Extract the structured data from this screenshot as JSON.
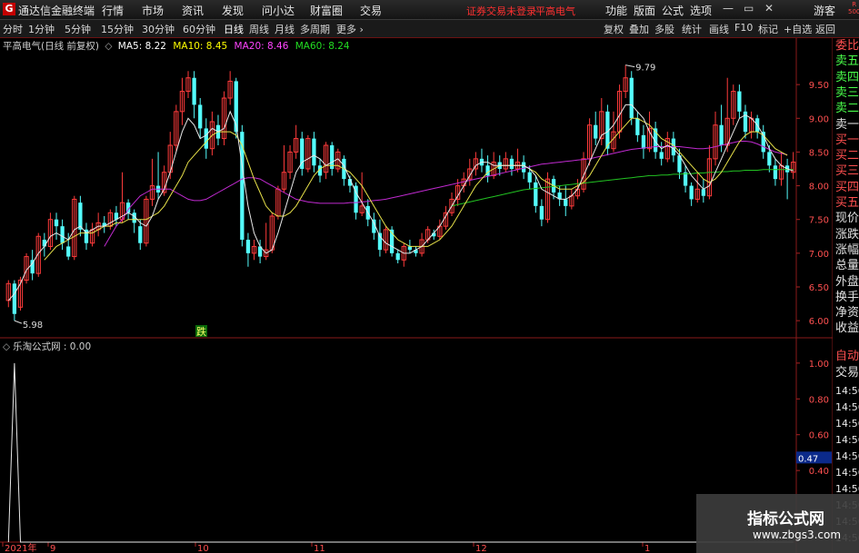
{
  "app": {
    "logo_char": "G",
    "title": "通达信金融终端",
    "menu": [
      "行情",
      "市场",
      "资讯",
      "发现",
      "问小达",
      "财富圈",
      "交易"
    ],
    "login_status": "证券交易未登录",
    "stock_name": "平高电气",
    "right_menu": [
      "功能",
      "版面",
      "公式",
      "选项"
    ],
    "guest": "游客",
    "window_controls": [
      "—",
      "▭",
      "✕"
    ],
    "badge": "R\n500"
  },
  "toolbar": {
    "periods": [
      "分时",
      "1分钟",
      "5分钟",
      "15分钟",
      "30分钟",
      "60分钟",
      "日线",
      "周线",
      "月线",
      "多周期",
      "更多 ›"
    ],
    "active_period": "日线",
    "buttons": [
      "复权",
      "叠加",
      "多股",
      "统计",
      "画线",
      "F10",
      "标记",
      "+自选",
      "返回"
    ],
    "settings_icon": "◇"
  },
  "main_chart": {
    "stock_label": "平高电气(日线 前复权)",
    "ma_labels": [
      {
        "text": "MA5: 8.22",
        "color": "#ffffff"
      },
      {
        "text": "MA10: 8.45",
        "color": "#ffff00"
      },
      {
        "text": "MA20: 8.46",
        "color": "#ff00ff"
      },
      {
        "text": "MA60: 8.24",
        "color": "#00dd00"
      }
    ],
    "high_marker": "9.79",
    "low_marker": "5.98",
    "signal_marker": "跌",
    "price_axis": [
      "9.50",
      "9.00",
      "8.50",
      "8.00",
      "7.50",
      "7.00",
      "6.50",
      "6.00"
    ]
  },
  "sub_chart": {
    "label": "乐淘公式网 : 0.00",
    "axis": [
      "1.00",
      "0.80",
      "0.60",
      "0.40"
    ],
    "current_value": "0.47"
  },
  "date_axis": [
    "2021年",
    "9",
    "10",
    "11",
    "12",
    "1"
  ],
  "side_panel": {
    "quote_labels": [
      "委比",
      "卖五",
      "卖四",
      "卖三",
      "卖二",
      "卖一",
      "买一",
      "买二",
      "买三",
      "买四",
      "买五",
      "现价",
      "涨跌",
      "涨幅",
      "总量",
      "外盘",
      "换手",
      "净资",
      "收益"
    ],
    "lower_labels": [
      "自动",
      "交易"
    ],
    "times": [
      "14:56",
      "14:56",
      "14:56",
      "14:56",
      "14:56",
      "14:56",
      "14:56",
      "14:56",
      "14:56",
      "14:56"
    ]
  },
  "watermark": {
    "title": "指标公式网",
    "url": "www.zbgs3.com"
  },
  "chart_data": {
    "type": "candlestick",
    "ylim": [
      5.8,
      10.0
    ],
    "up_color": "#ff3b3b",
    "down_color": "#54fcfc",
    "candles": [
      [
        6.3,
        6.55,
        6.2,
        6.6
      ],
      [
        6.55,
        6.1,
        6.0,
        6.6
      ],
      [
        6.2,
        6.6,
        6.15,
        6.65
      ],
      [
        6.6,
        6.95,
        6.55,
        7.0
      ],
      [
        6.9,
        6.7,
        6.6,
        7.05
      ],
      [
        6.7,
        7.25,
        6.65,
        7.3
      ],
      [
        7.2,
        7.1,
        6.95,
        7.3
      ],
      [
        7.1,
        7.5,
        7.05,
        7.6
      ],
      [
        7.5,
        7.4,
        7.2,
        7.6
      ],
      [
        7.4,
        7.15,
        7.05,
        7.5
      ],
      [
        7.1,
        6.95,
        6.9,
        7.3
      ],
      [
        6.95,
        7.8,
        6.9,
        7.85
      ],
      [
        7.75,
        7.35,
        7.25,
        7.85
      ],
      [
        7.35,
        7.15,
        7.05,
        7.45
      ],
      [
        7.15,
        7.35,
        7.1,
        7.45
      ],
      [
        7.35,
        7.45,
        7.25,
        7.6
      ],
      [
        7.45,
        7.4,
        7.3,
        7.55
      ],
      [
        7.4,
        7.6,
        7.35,
        7.65
      ],
      [
        7.6,
        7.5,
        7.4,
        7.7
      ],
      [
        7.5,
        7.75,
        7.45,
        8.2
      ],
      [
        7.75,
        7.6,
        7.5,
        7.8
      ],
      [
        7.6,
        7.45,
        7.3,
        7.65
      ],
      [
        7.4,
        7.15,
        7.05,
        7.5
      ],
      [
        7.15,
        7.8,
        7.1,
        7.85
      ],
      [
        7.8,
        8.0,
        7.7,
        8.4
      ],
      [
        8.0,
        7.9,
        7.8,
        8.5
      ],
      [
        7.9,
        8.2,
        7.85,
        8.3
      ],
      [
        8.2,
        8.6,
        8.1,
        8.8
      ],
      [
        8.6,
        9.1,
        8.5,
        9.2
      ],
      [
        9.1,
        9.4,
        8.9,
        9.6
      ],
      [
        9.4,
        9.6,
        9.3,
        9.7
      ],
      [
        9.6,
        9.2,
        9.0,
        9.7
      ],
      [
        9.2,
        8.85,
        8.7,
        9.3
      ],
      [
        8.85,
        8.55,
        8.4,
        9.0
      ],
      [
        8.55,
        8.95,
        8.45,
        9.1
      ],
      [
        8.9,
        8.7,
        8.6,
        9.05
      ],
      [
        8.7,
        9.3,
        8.6,
        9.4
      ],
      [
        9.3,
        9.55,
        9.2,
        9.7
      ],
      [
        9.55,
        8.8,
        8.7,
        9.6
      ],
      [
        8.8,
        7.2,
        7.1,
        8.9
      ],
      [
        7.2,
        7.0,
        6.8,
        7.3
      ],
      [
        7.0,
        7.1,
        6.9,
        7.2
      ],
      [
        7.1,
        6.95,
        6.85,
        7.2
      ],
      [
        6.95,
        7.05,
        6.9,
        7.45
      ],
      [
        7.05,
        7.55,
        7.0,
        7.6
      ],
      [
        7.55,
        7.95,
        7.5,
        8.0
      ],
      [
        7.95,
        8.2,
        7.9,
        8.6
      ],
      [
        8.2,
        8.5,
        8.1,
        8.6
      ],
      [
        8.5,
        8.7,
        8.4,
        8.9
      ],
      [
        8.7,
        8.25,
        8.15,
        8.8
      ],
      [
        8.25,
        8.7,
        8.2,
        8.75
      ],
      [
        8.7,
        8.3,
        8.2,
        8.8
      ],
      [
        8.3,
        8.15,
        8.05,
        8.4
      ],
      [
        8.2,
        8.6,
        8.1,
        8.65
      ],
      [
        8.6,
        8.25,
        8.15,
        8.65
      ],
      [
        8.25,
        8.5,
        8.2,
        8.55
      ],
      [
        8.4,
        8.1,
        8.0,
        8.45
      ],
      [
        8.1,
        8.0,
        7.9,
        8.15
      ],
      [
        8.0,
        7.6,
        7.5,
        8.05
      ],
      [
        7.6,
        7.7,
        7.55,
        8.2
      ],
      [
        7.7,
        7.5,
        7.4,
        7.8
      ],
      [
        7.5,
        7.3,
        7.2,
        7.6
      ],
      [
        7.3,
        7.05,
        6.95,
        7.5
      ],
      [
        7.05,
        7.35,
        7.0,
        7.4
      ],
      [
        7.35,
        7.0,
        6.95,
        7.4
      ],
      [
        7.0,
        6.9,
        6.85,
        7.05
      ],
      [
        6.9,
        7.1,
        6.8,
        7.15
      ],
      [
        7.1,
        7.05,
        7.0,
        7.2
      ],
      [
        7.05,
        7.0,
        6.95,
        7.1
      ],
      [
        7.0,
        7.2,
        6.95,
        7.3
      ],
      [
        7.2,
        7.35,
        7.15,
        7.4
      ],
      [
        7.3,
        7.25,
        7.2,
        7.35
      ],
      [
        7.25,
        7.4,
        7.2,
        7.5
      ],
      [
        7.4,
        7.6,
        7.35,
        7.7
      ],
      [
        7.6,
        7.8,
        7.55,
        7.9
      ],
      [
        7.8,
        8.0,
        7.7,
        8.1
      ],
      [
        8.0,
        8.1,
        7.9,
        8.2
      ],
      [
        8.1,
        8.25,
        8.0,
        8.4
      ],
      [
        8.25,
        8.4,
        8.15,
        8.5
      ],
      [
        8.4,
        8.3,
        8.2,
        8.55
      ],
      [
        8.3,
        8.15,
        8.05,
        8.45
      ],
      [
        8.15,
        8.35,
        8.1,
        8.5
      ],
      [
        8.35,
        8.25,
        8.15,
        8.45
      ],
      [
        8.25,
        8.4,
        8.2,
        8.5
      ],
      [
        8.4,
        8.25,
        8.15,
        8.45
      ],
      [
        8.25,
        8.35,
        8.2,
        8.55
      ],
      [
        8.35,
        8.2,
        8.1,
        8.45
      ],
      [
        8.2,
        8.05,
        7.95,
        8.3
      ],
      [
        8.05,
        7.7,
        7.6,
        8.15
      ],
      [
        7.7,
        7.5,
        7.4,
        7.8
      ],
      [
        7.5,
        8.1,
        7.45,
        8.2
      ],
      [
        8.1,
        7.9,
        7.8,
        8.15
      ],
      [
        7.9,
        7.8,
        7.7,
        8.0
      ],
      [
        7.8,
        7.7,
        7.55,
        8.0
      ],
      [
        7.7,
        7.85,
        7.65,
        7.95
      ],
      [
        7.85,
        7.95,
        7.8,
        8.1
      ],
      [
        7.95,
        8.4,
        7.9,
        8.5
      ],
      [
        8.4,
        8.9,
        8.3,
        9.0
      ],
      [
        8.9,
        8.7,
        8.6,
        9.1
      ],
      [
        8.7,
        9.1,
        8.6,
        9.3
      ],
      [
        9.1,
        8.55,
        8.45,
        9.2
      ],
      [
        8.55,
        8.8,
        8.5,
        9.1
      ],
      [
        8.8,
        9.4,
        8.7,
        9.5
      ],
      [
        9.4,
        9.6,
        9.3,
        9.79
      ],
      [
        9.6,
        9.0,
        8.9,
        9.7
      ],
      [
        9.0,
        8.75,
        8.65,
        9.1
      ],
      [
        8.75,
        8.55,
        8.4,
        8.9
      ],
      [
        8.55,
        8.85,
        8.5,
        9.1
      ],
      [
        8.85,
        8.5,
        8.4,
        8.95
      ],
      [
        8.5,
        8.4,
        8.3,
        8.65
      ],
      [
        8.4,
        8.7,
        8.35,
        8.8
      ],
      [
        8.7,
        8.45,
        8.35,
        8.8
      ],
      [
        8.45,
        8.2,
        8.1,
        8.55
      ],
      [
        8.2,
        8.0,
        7.9,
        8.3
      ],
      [
        8.0,
        7.8,
        7.7,
        8.05
      ],
      [
        7.8,
        7.95,
        7.75,
        8.2
      ],
      [
        7.95,
        7.85,
        7.75,
        8.1
      ],
      [
        7.85,
        8.4,
        7.8,
        8.6
      ],
      [
        8.4,
        8.9,
        8.3,
        9.1
      ],
      [
        8.9,
        8.6,
        8.5,
        9.2
      ],
      [
        8.6,
        9.0,
        8.5,
        9.6
      ],
      [
        9.0,
        9.4,
        8.9,
        9.5
      ],
      [
        9.4,
        9.1,
        9.0,
        9.5
      ],
      [
        9.1,
        8.8,
        8.7,
        9.2
      ],
      [
        8.8,
        9.0,
        8.7,
        9.1
      ],
      [
        9.0,
        8.8,
        8.7,
        9.05
      ],
      [
        8.8,
        8.5,
        8.4,
        8.9
      ],
      [
        8.5,
        8.3,
        8.2,
        8.6
      ],
      [
        8.3,
        8.1,
        8.0,
        8.4
      ],
      [
        8.1,
        8.3,
        8.0,
        8.5
      ],
      [
        8.3,
        8.2,
        7.8,
        8.4
      ],
      [
        8.2,
        8.35,
        8.1,
        8.5
      ]
    ],
    "ma5": [
      6.3,
      6.4,
      6.55,
      6.75,
      6.85,
      7.0,
      7.1,
      7.25,
      7.3,
      7.25,
      7.2,
      7.35,
      7.4,
      7.3,
      7.35,
      7.4,
      7.4,
      7.45,
      7.5,
      7.55,
      7.6,
      7.55,
      7.45,
      7.4,
      7.55,
      7.8,
      7.95,
      8.2,
      8.5,
      8.8,
      9.0,
      8.9,
      8.7,
      8.75,
      8.85,
      8.8,
      8.85,
      9.1,
      8.9,
      8.3,
      7.7,
      7.3,
      7.1,
      7.0,
      7.05,
      7.3,
      7.6,
      7.9,
      8.2,
      8.35,
      8.4,
      8.45,
      8.4,
      8.3,
      8.35,
      8.4,
      8.3,
      8.1,
      7.9,
      7.75,
      7.6,
      7.45,
      7.25,
      7.15,
      7.1,
      7.05,
      7.0,
      7.0,
      7.05,
      7.1,
      7.2,
      7.3,
      7.4,
      7.55,
      7.7,
      7.85,
      8.0,
      8.15,
      8.3,
      8.35,
      8.35,
      8.3,
      8.3,
      8.3,
      8.3,
      8.3,
      8.3,
      8.25,
      8.15,
      7.95,
      7.9,
      7.85,
      7.8,
      7.8,
      7.85,
      7.95,
      8.15,
      8.35,
      8.55,
      8.75,
      8.8,
      8.9,
      9.05,
      9.2,
      9.2,
      9.1,
      9.0,
      8.8,
      8.65,
      8.55,
      8.6,
      8.55,
      8.45,
      8.3,
      8.15,
      8.05,
      7.95,
      8.0,
      8.2,
      8.4,
      8.6,
      8.8,
      9.0,
      9.05,
      9.0,
      8.9,
      8.75,
      8.55,
      8.4,
      8.3,
      8.25,
      8.22
    ],
    "ma10": [
      null,
      null,
      null,
      null,
      null,
      null,
      6.9,
      7.0,
      7.1,
      7.15,
      7.2,
      7.25,
      7.3,
      7.3,
      7.3,
      7.35,
      7.4,
      7.4,
      7.45,
      7.45,
      7.5,
      7.5,
      7.5,
      7.5,
      7.55,
      7.6,
      7.7,
      7.85,
      8.0,
      8.15,
      8.35,
      8.45,
      8.55,
      8.65,
      8.75,
      8.8,
      8.8,
      8.8,
      8.75,
      8.6,
      8.35,
      8.1,
      7.9,
      7.7,
      7.6,
      7.55,
      7.55,
      7.6,
      7.7,
      7.85,
      8.0,
      8.15,
      8.25,
      8.3,
      8.3,
      8.3,
      8.25,
      8.2,
      8.1,
      8.0,
      7.85,
      7.7,
      7.55,
      7.4,
      7.3,
      7.2,
      7.15,
      7.1,
      7.1,
      7.1,
      7.1,
      7.15,
      7.2,
      7.3,
      7.4,
      7.55,
      7.7,
      7.85,
      8.0,
      8.1,
      8.2,
      8.25,
      8.3,
      8.3,
      8.3,
      8.3,
      8.3,
      8.25,
      8.2,
      8.1,
      8.05,
      8.0,
      7.95,
      7.95,
      7.95,
      8.0,
      8.05,
      8.15,
      8.3,
      8.45,
      8.6,
      8.7,
      8.8,
      8.9,
      9.0,
      9.0,
      8.95,
      8.9,
      8.8,
      8.7,
      8.65,
      8.6,
      8.5,
      8.4,
      8.3,
      8.2,
      8.1,
      8.05,
      8.1,
      8.2,
      8.35,
      8.5,
      8.65,
      8.75,
      8.8,
      8.8,
      8.75,
      8.65,
      8.55,
      8.5,
      8.45
    ],
    "ma20": [
      null,
      null,
      null,
      null,
      null,
      null,
      null,
      null,
      null,
      null,
      null,
      null,
      null,
      null,
      null,
      null,
      7.1,
      7.25,
      7.4,
      7.5,
      7.65,
      7.75,
      7.85,
      7.9,
      7.95,
      7.95,
      7.95,
      7.95,
      7.9,
      7.85,
      7.8,
      7.78,
      7.78,
      7.8,
      7.85,
      7.9,
      7.95,
      8.0,
      8.05,
      8.1,
      8.12,
      8.12,
      8.1,
      8.05,
      8.0,
      7.95,
      7.9,
      7.85,
      7.8,
      7.78,
      7.76,
      7.75,
      7.74,
      7.74,
      7.74,
      7.74,
      7.74,
      7.75,
      7.75,
      7.76,
      7.77,
      7.78,
      7.79,
      7.8,
      7.82,
      7.84,
      7.86,
      7.88,
      7.9,
      7.92,
      7.94,
      7.96,
      7.98,
      8.0,
      8.02,
      8.04,
      8.06,
      8.08,
      8.1,
      8.12,
      8.14,
      8.16,
      8.18,
      8.2,
      8.22,
      8.24,
      8.26,
      8.28,
      8.3,
      8.32,
      8.33,
      8.34,
      8.35,
      8.36,
      8.37,
      8.38,
      8.39,
      8.4,
      8.42,
      8.44,
      8.46,
      8.48,
      8.5,
      8.52,
      8.54,
      8.55,
      8.56,
      8.57,
      8.58,
      8.58,
      8.58,
      8.58,
      8.58,
      8.57,
      8.56,
      8.55,
      8.55,
      8.56,
      8.58,
      8.6,
      8.62,
      8.64,
      8.66,
      8.66,
      8.65,
      8.62,
      8.58,
      8.54,
      8.5,
      8.48,
      8.46
    ],
    "ma60": [
      null,
      null,
      null,
      null,
      null,
      null,
      null,
      null,
      null,
      null,
      null,
      null,
      null,
      null,
      null,
      null,
      null,
      null,
      null,
      null,
      null,
      null,
      null,
      null,
      null,
      null,
      null,
      null,
      null,
      null,
      null,
      null,
      null,
      null,
      null,
      null,
      null,
      null,
      null,
      null,
      null,
      null,
      null,
      null,
      null,
      null,
      null,
      null,
      null,
      null,
      null,
      null,
      null,
      null,
      null,
      null,
      null,
      null,
      null,
      null,
      null,
      null,
      null,
      null,
      null,
      null,
      null,
      null,
      null,
      null,
      null,
      null,
      null,
      null,
      7.7,
      7.72,
      7.74,
      7.76,
      7.78,
      7.8,
      7.82,
      7.84,
      7.86,
      7.88,
      7.9,
      7.92,
      7.94,
      7.95,
      7.96,
      7.97,
      7.98,
      7.99,
      8.0,
      8.01,
      8.02,
      8.03,
      8.04,
      8.05,
      8.06,
      8.07,
      8.08,
      8.09,
      8.1,
      8.11,
      8.12,
      8.13,
      8.14,
      8.15,
      8.15,
      8.16,
      8.16,
      8.17,
      8.17,
      8.18,
      8.18,
      8.19,
      8.19,
      8.2,
      8.2,
      8.21,
      8.21,
      8.22,
      8.22,
      8.23,
      8.23,
      8.23,
      8.24,
      8.24,
      8.24,
      8.24,
      8.24,
      8.24
    ],
    "sub_values": [
      0,
      1,
      0,
      0,
      0,
      0,
      0,
      0,
      0,
      0,
      0,
      0,
      0,
      0,
      0,
      0,
      0,
      0,
      0,
      0,
      0,
      0,
      0,
      0,
      0,
      0,
      0,
      0,
      0,
      0,
      0,
      0,
      0,
      0,
      0,
      0,
      0,
      0,
      0,
      0,
      0,
      0,
      0,
      0,
      0,
      0,
      0,
      0,
      0,
      0,
      0,
      0,
      0,
      0,
      0,
      0,
      0,
      0,
      0,
      0,
      0,
      0,
      0,
      0,
      0,
      0,
      0,
      0,
      0,
      0,
      0,
      0,
      0,
      0,
      0,
      0,
      0,
      0,
      0,
      0,
      0,
      0,
      0,
      0,
      0,
      0,
      0,
      0,
      0,
      0,
      0,
      0,
      0,
      0,
      0,
      0,
      0,
      0,
      0,
      0,
      0,
      0,
      0,
      0,
      0,
      0,
      0,
      0,
      0,
      0,
      0,
      0,
      0,
      0,
      0,
      0,
      0,
      0,
      0,
      0,
      0,
      0,
      0,
      0,
      0,
      0,
      0,
      0,
      0,
      0,
      0,
      0
    ],
    "sub_ylim": [
      0,
      1.05
    ]
  }
}
